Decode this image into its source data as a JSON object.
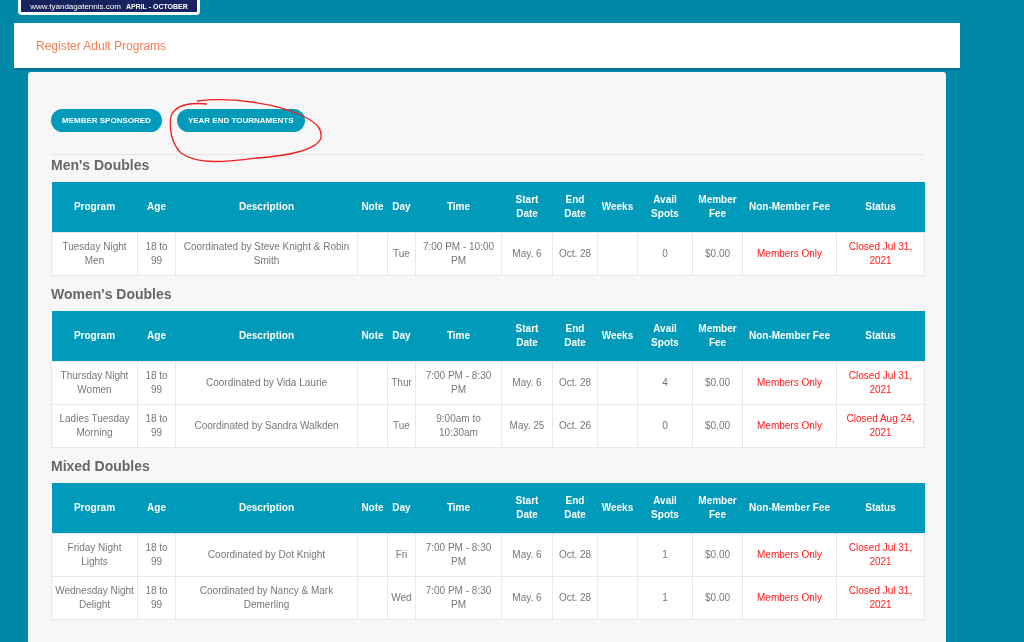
{
  "logo": {
    "url": "www.tyandagatennis.com",
    "season": "APRIL - OCTOBER"
  },
  "page_title": "Register Adult Programs",
  "buttons": [
    {
      "label": "MEMBER SPONSORED",
      "circled": false
    },
    {
      "label": "YEAR END TOURNAMENTS",
      "circled": true
    }
  ],
  "sections": [
    {
      "title": "Men's Doubles",
      "columns": [
        "Program",
        "Age",
        "Description",
        "Note",
        "Day",
        "Time",
        "Start Date",
        "End Date",
        "Weeks",
        "Avail Spots",
        "Member Fee",
        "Non-Member Fee",
        "Status"
      ],
      "rows": [
        [
          "Tuesday Night Men",
          "18 to 99",
          "Coordinated by Steve Knight & Robin Smith",
          "",
          "Tue",
          "7:00 PM - 10:00 PM",
          "May. 6",
          "Oct. 28",
          "",
          "0",
          "$0.00",
          "Members Only",
          "Closed Jul 31, 2021"
        ]
      ]
    },
    {
      "title": "Women's Doubles",
      "columns": [
        "Program",
        "Age",
        "Description",
        "Note",
        "Day",
        "Time",
        "Start Date",
        "End Date",
        "Weeks",
        "Avail Spots",
        "Member Fee",
        "Non-Member Fee",
        "Status"
      ],
      "rows": [
        [
          "Thursday Night Women",
          "18 to 99",
          "Coordinated by Vida Laurie",
          "",
          "Thur",
          "7:00 PM - 8:30 PM",
          "May. 6",
          "Oct. 28",
          "",
          "4",
          "$0.00",
          "Members Only",
          "Closed Jul 31, 2021"
        ],
        [
          "Ladies Tuesday Morning",
          "18 to 99",
          "Coordinated by Sandra Walkden",
          "",
          "Tue",
          "9:00am to 10:30am",
          "May. 25",
          "Oct. 26",
          "",
          "0",
          "$0.00",
          "Members Only",
          "Closed Aug 24, 2021"
        ]
      ]
    },
    {
      "title": "Mixed Doubles",
      "columns": [
        "Program",
        "Age",
        "Description",
        "Note",
        "Day",
        "Time",
        "Start Date",
        "End Date",
        "Weeks",
        "Avail Spots",
        "Member Fee",
        "Non-Member Fee",
        "Status"
      ],
      "rows": [
        [
          "Friday Night Lights",
          "18 to 99",
          "Coordinated by Dot Knight",
          "",
          "Fri",
          "7:00 PM - 8:30 PM",
          "May. 6",
          "Oct. 28",
          "",
          "1",
          "$0.00",
          "Members Only",
          "Closed Jul 31, 2021"
        ],
        [
          "Wednesday Night Delight",
          "18 to 99",
          "Coordinated by Nancy & Mark Demerling",
          "",
          "Wed",
          "7:00 PM - 8:30 PM",
          "May. 6",
          "Oct. 28",
          "",
          "1",
          "$0.00",
          "Members Only",
          "Closed Jul 31, 2021"
        ]
      ]
    }
  ]
}
